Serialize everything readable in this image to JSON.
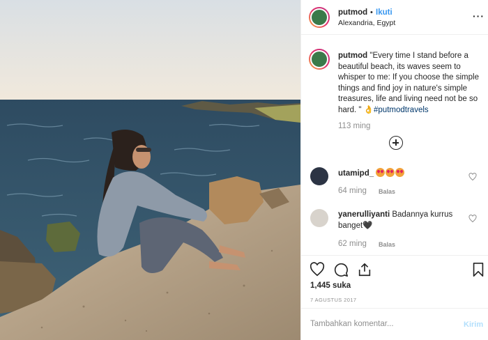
{
  "post": {
    "username": "putmod",
    "separator": "•",
    "follow_label": "Ikuti",
    "location": "Alexandria, Egypt",
    "more_label": "···"
  },
  "caption": {
    "username": "putmod",
    "text": "\"Every time I stand before a beautiful beach, its waves seem to whisper to me: If you choose the simple things and find joy in nature's simple treasures, life and living need not be so hard. \" ",
    "emoji": "👌",
    "hashtag": "#putmodtravels",
    "time": "113 ming"
  },
  "comments": [
    {
      "username": "utamipd_",
      "text": "",
      "emoji_count": 3,
      "time": "64 ming",
      "reply_label": "Balas"
    },
    {
      "username": "yanerulliyanti",
      "text": "Badannya kurrus banget🖤",
      "time": "62 ming",
      "reply_label": "Balas"
    }
  ],
  "stats": {
    "likes": "1,445 suka",
    "date": "7 AGUSTUS 2017"
  },
  "icons": [
    "heart-icon",
    "comment-icon",
    "share-icon",
    "bookmark-icon",
    "plus-circle-icon",
    "more-icon"
  ],
  "add_comment": {
    "placeholder": "Tambahkan komentar...",
    "post_label": "Kirim"
  },
  "colors": {
    "link": "#3897f0",
    "hashtag": "#00376b",
    "muted": "#8e8e8e",
    "post_disabled": "#b2dffc"
  }
}
